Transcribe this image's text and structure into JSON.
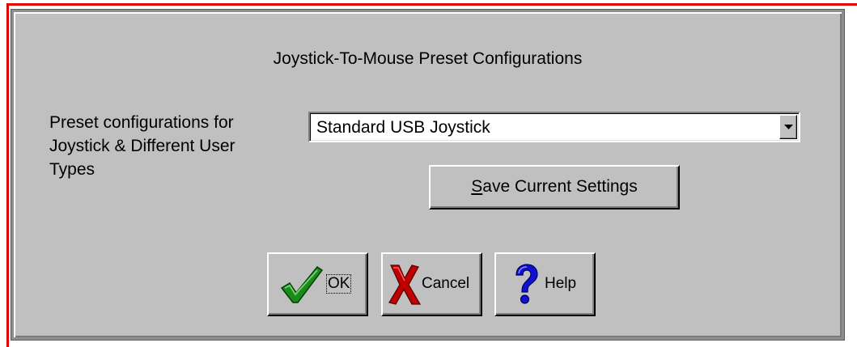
{
  "dialog": {
    "title": "Joystick-To-Mouse Preset Configurations",
    "preset_label": "Preset configurations for Joystick & Different User Types",
    "preset_select": {
      "value": "Standard USB Joystick"
    },
    "save_button": {
      "mnemonic": "S",
      "label_rest": "ave Current Settings"
    },
    "buttons": {
      "ok": {
        "label": "OK",
        "icon": "checkmark-icon"
      },
      "cancel": {
        "label": "Cancel",
        "icon": "x-mark-icon"
      },
      "help": {
        "label": "Help",
        "icon": "question-mark-icon"
      }
    }
  },
  "colors": {
    "dialog_bg": "#c0c0c0",
    "selection_frame": "#e00000",
    "ok_icon": "#1a8a1a",
    "cancel_icon": "#c00000",
    "help_icon": "#1010d0"
  }
}
